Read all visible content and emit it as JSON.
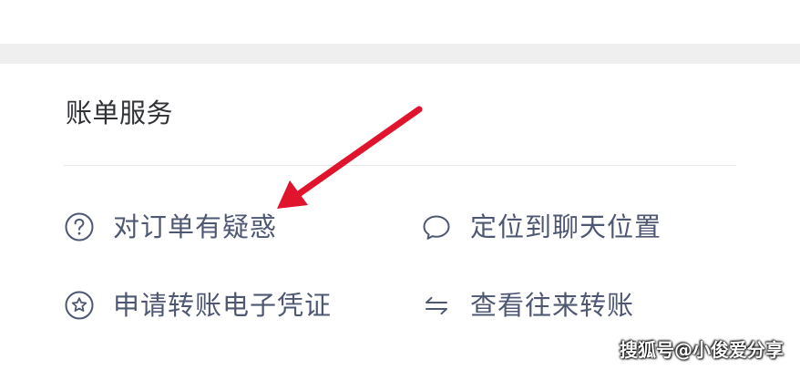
{
  "bill_services": {
    "title": "账单服务",
    "items": [
      {
        "label": "对订单有疑惑",
        "icon": "question-circle-icon"
      },
      {
        "label": "定位到聊天位置",
        "icon": "chat-bubble-icon"
      },
      {
        "label": "申请转账电子凭证",
        "icon": "star-badge-icon"
      },
      {
        "label": "查看往来转账",
        "icon": "transfer-arrows-icon"
      }
    ]
  },
  "watermark": "搜狐号@小俊爱分享",
  "colors": {
    "text_primary": "#303236",
    "text_item": "#4e5873",
    "annotation_arrow": "#e0142c",
    "background": "#f0f0f0"
  }
}
